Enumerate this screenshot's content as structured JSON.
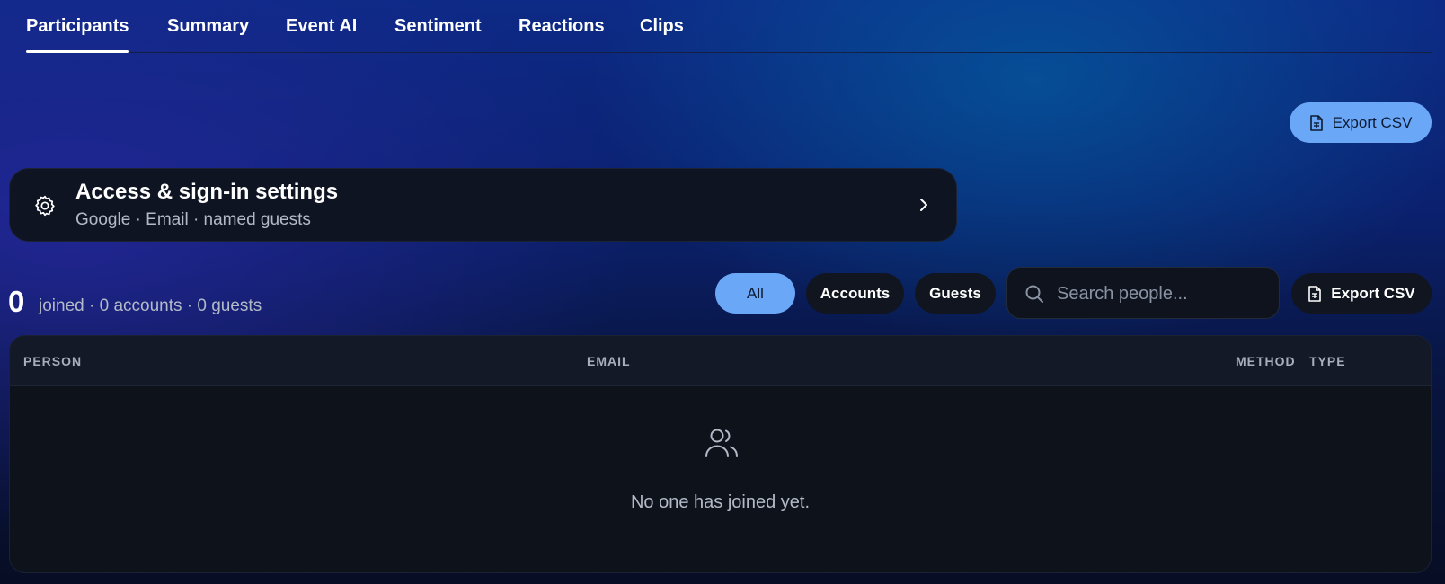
{
  "tabs": [
    {
      "label": "Participants",
      "active": true
    },
    {
      "label": "Summary"
    },
    {
      "label": "Event AI"
    },
    {
      "label": "Sentiment"
    },
    {
      "label": "Reactions"
    },
    {
      "label": "Clips"
    }
  ],
  "export_top": {
    "label": "Export CSV",
    "icon": "file-icon"
  },
  "settings": {
    "title": "Access & sign-in settings",
    "subtitle": "Google · Email · named guests",
    "icon": "gear-icon"
  },
  "summary": {
    "count": "0",
    "text": "joined · 0 accounts · 0 guests"
  },
  "filters": {
    "all": "All",
    "accounts": "Accounts",
    "guests": "Guests",
    "selected": "All"
  },
  "search": {
    "placeholder": "Search people...",
    "value": ""
  },
  "export_dark": {
    "label": "Export CSV",
    "icon": "file-icon"
  },
  "table": {
    "columns": [
      "PERSON",
      "EMAIL",
      "METHOD",
      "TYPE"
    ],
    "empty_text": "No one has joined yet."
  },
  "colors": {
    "accent": "#6aa8f7",
    "card": "#0f1422"
  }
}
